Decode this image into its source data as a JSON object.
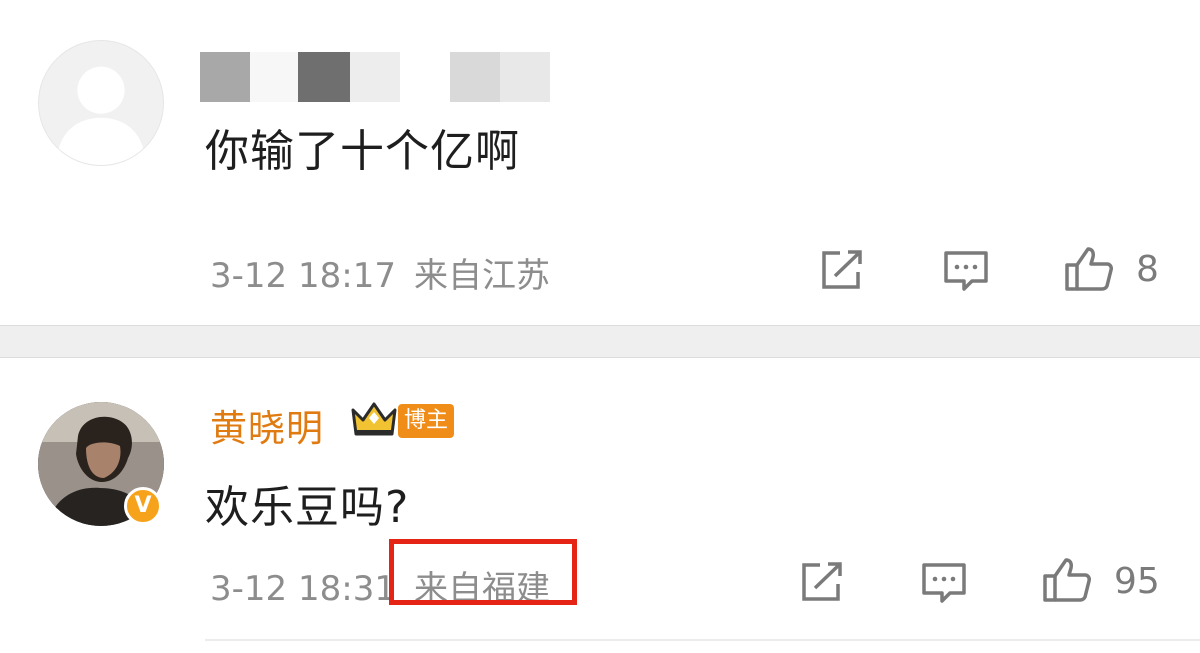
{
  "comments": [
    {
      "username": "",
      "text": "你输了十个亿啊",
      "timestamp": "3-12 18:17",
      "location": "来自江苏",
      "likes": "8",
      "avatar_icon": "default-avatar-icon"
    },
    {
      "username": "黄晓明",
      "badge": "博主",
      "text": "欢乐豆吗?",
      "timestamp": "3-12 18:31",
      "location": "来自福建",
      "likes": "95",
      "avatar_icon": "verified-v-icon",
      "verified_label": "V"
    }
  ],
  "icons": {
    "share": "share-icon",
    "comment": "comment-icon",
    "like": "thumbs-up-icon",
    "crown": "crown-icon"
  },
  "colors": {
    "username": "#e07b12",
    "badge": "#f08d18",
    "highlight": "#e52415",
    "meta": "#8d8d8d"
  }
}
